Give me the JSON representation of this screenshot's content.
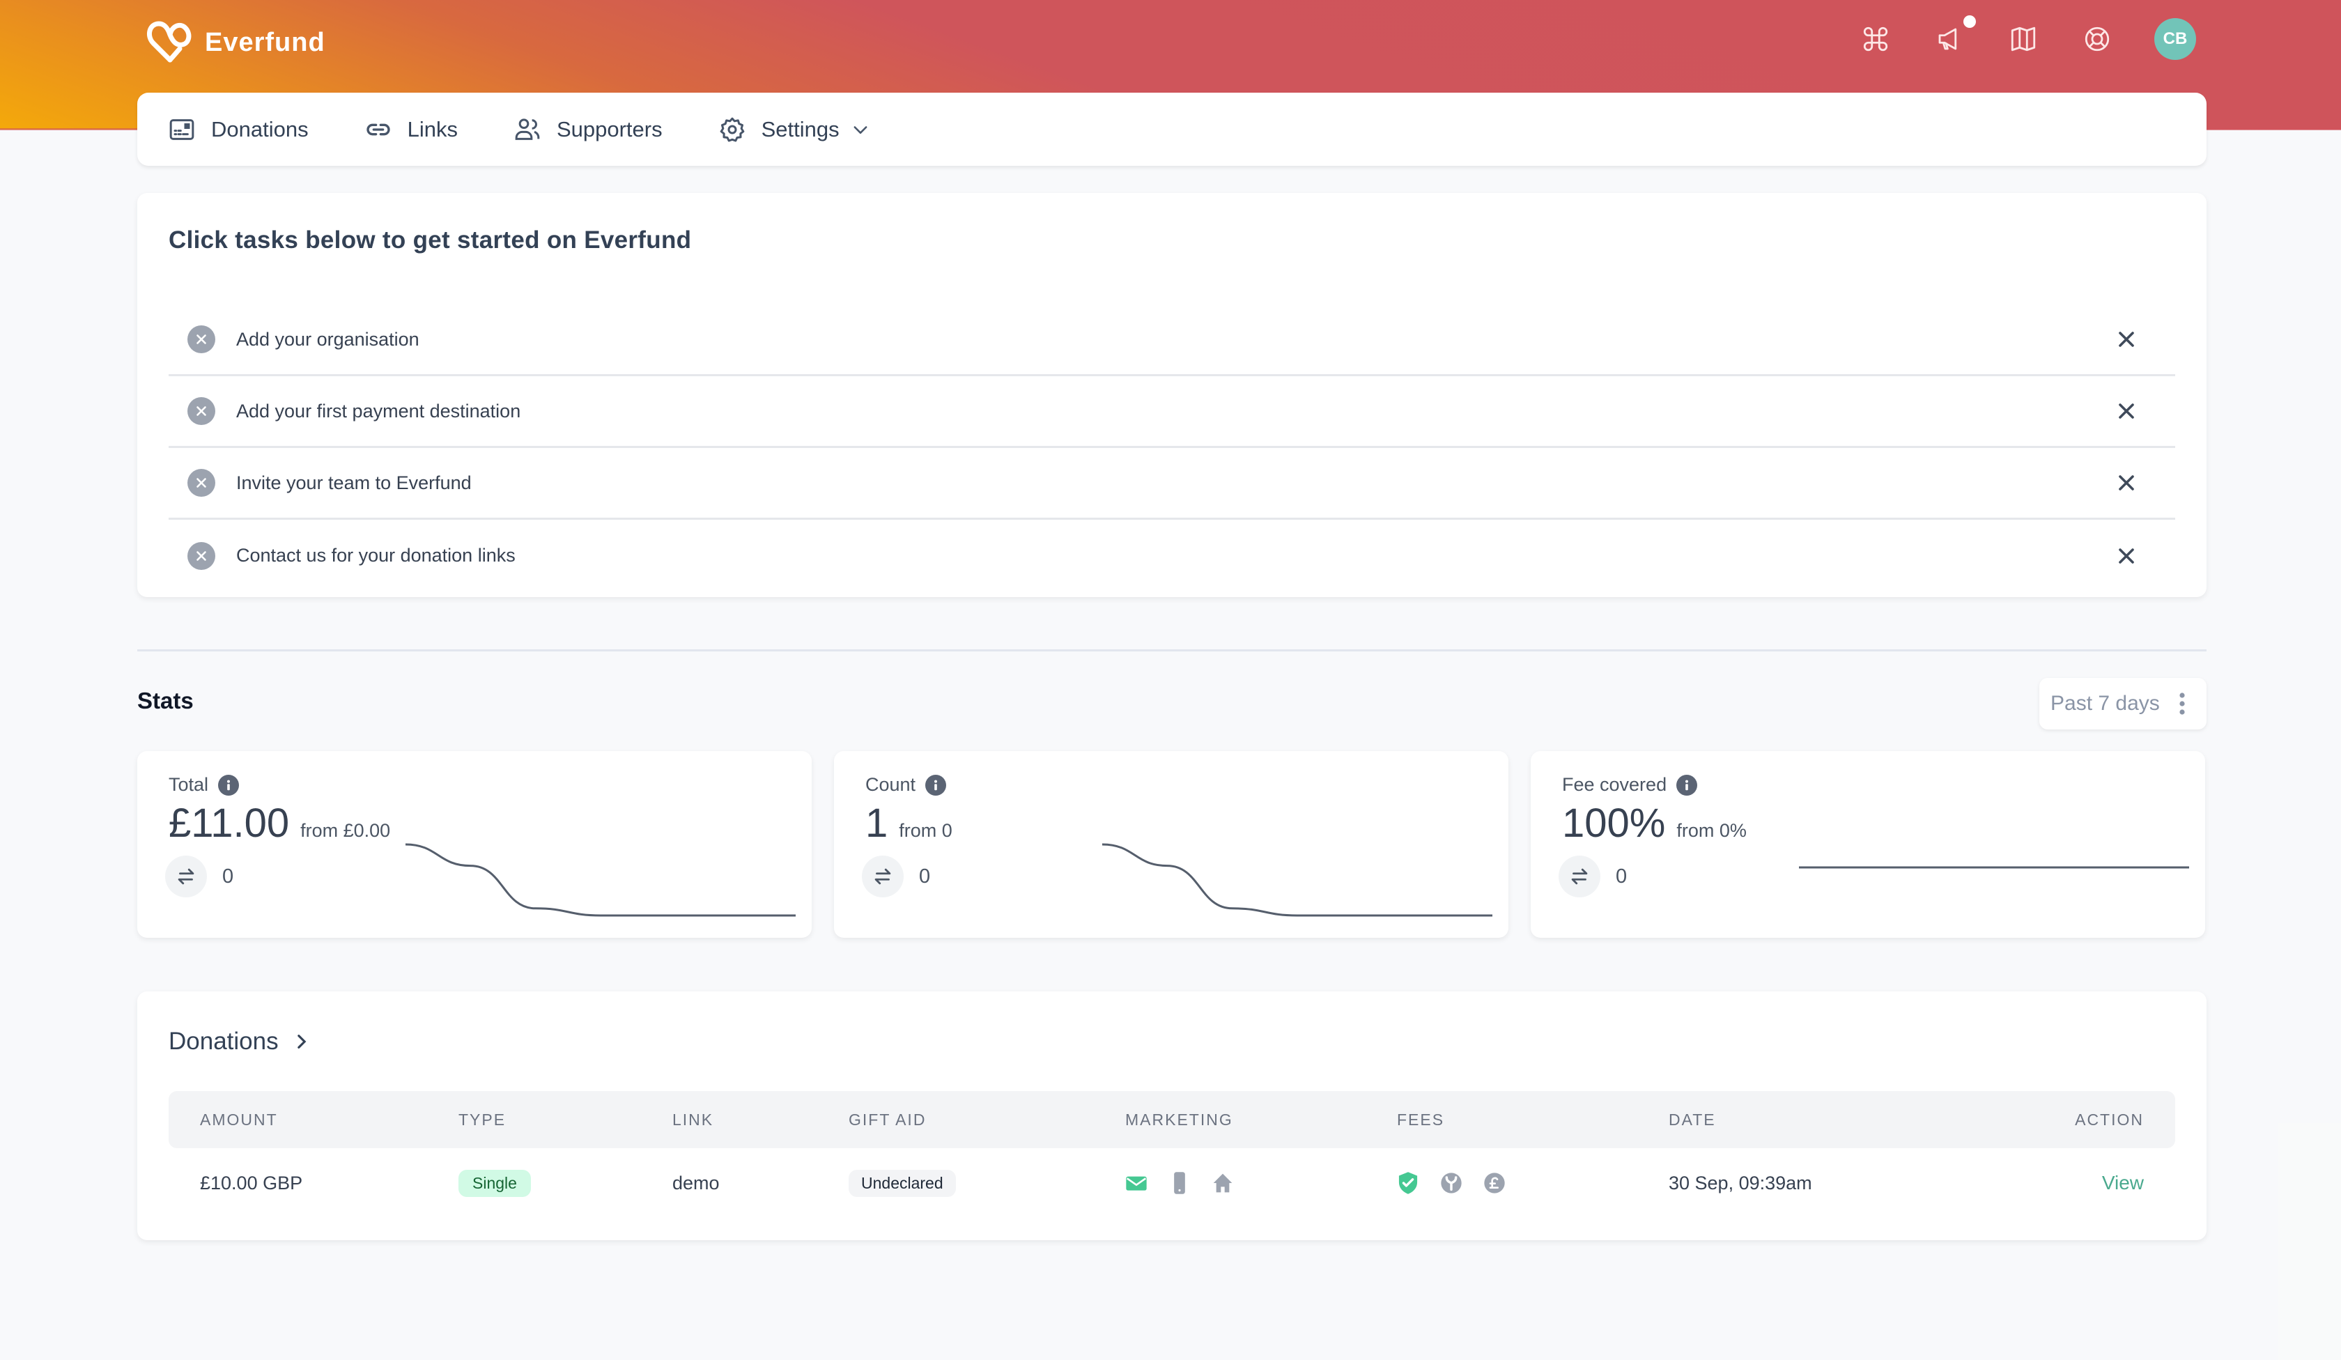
{
  "app": {
    "name": "Everfund",
    "brand_gradient": [
      "#cf545b",
      "#f4a90a"
    ],
    "accent": "#4aa98e"
  },
  "header": {
    "icons": [
      "command-icon",
      "megaphone-icon",
      "map-icon",
      "lifebuoy-icon"
    ],
    "has_notification": true,
    "avatar_initials": "CB",
    "avatar_color": "#72c4b8"
  },
  "nav": {
    "items": [
      {
        "label": "Donations",
        "icon": "donations-card-icon"
      },
      {
        "label": "Links",
        "icon": "link-icon"
      },
      {
        "label": "Supporters",
        "icon": "users-icon"
      },
      {
        "label": "Settings",
        "icon": "gear-icon",
        "has_dropdown": true
      }
    ]
  },
  "onboarding": {
    "title": "Click tasks below to get started on Everfund",
    "tasks": [
      {
        "label": "Add your organisation",
        "status": "incomplete"
      },
      {
        "label": "Add your first payment destination",
        "status": "incomplete"
      },
      {
        "label": "Invite your team to Everfund",
        "status": "incomplete"
      },
      {
        "label": "Contact us for your donation links",
        "status": "incomplete"
      }
    ]
  },
  "stats": {
    "title": "Stats",
    "period": "Past 7 days",
    "cards": [
      {
        "label": "Total",
        "value": "£11.00",
        "from": "from £0.00",
        "change": "0",
        "trend": [
          1,
          0.7,
          0.1,
          0,
          0,
          0,
          0
        ]
      },
      {
        "label": "Count",
        "value": "1",
        "from": "from 0",
        "change": "0",
        "trend": [
          1,
          0.7,
          0.1,
          0,
          0,
          0,
          0
        ]
      },
      {
        "label": "Fee covered",
        "value": "100%",
        "from": "from 0%",
        "change": "0",
        "trend": [
          1,
          1,
          1,
          1,
          1,
          1,
          1
        ]
      }
    ]
  },
  "donations": {
    "title": "Donations",
    "columns": [
      "AMOUNT",
      "TYPE",
      "LINK",
      "GIFT AID",
      "MARKETING",
      "FEES",
      "DATE",
      "ACTION"
    ],
    "rows": [
      {
        "amount": "£10.00 GBP",
        "type": "Single",
        "link": "demo",
        "gift_aid": "Undeclared",
        "marketing": {
          "email": true,
          "sms": false,
          "post": false
        },
        "fees": {
          "covered": true,
          "stripe": false,
          "platform": false
        },
        "date": "30 Sep, 09:39am",
        "action": "View"
      }
    ]
  }
}
